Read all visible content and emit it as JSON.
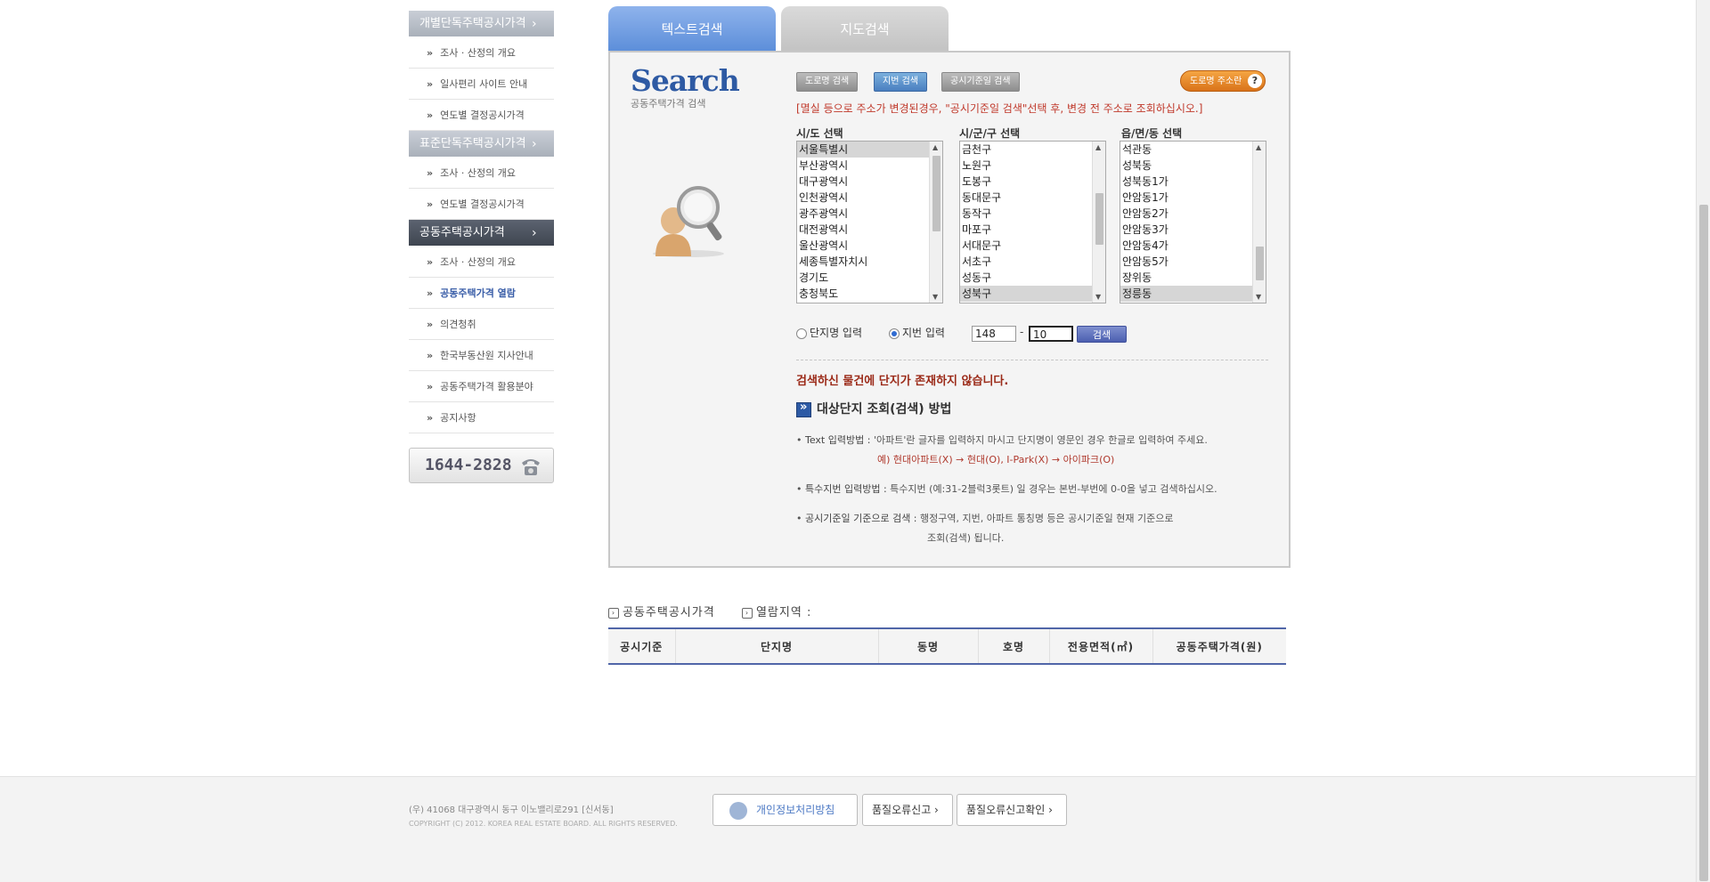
{
  "sidebar": {
    "sections": [
      {
        "title": "개별단독주택공시가격",
        "items": [
          "조사 · 산정의 개요",
          "일사편리 사이트 안내",
          "연도별 결정공시가격"
        ]
      },
      {
        "title": "표준단독주택공시가격",
        "items": [
          "조사 · 산정의 개요",
          "연도별 결정공시가격"
        ]
      },
      {
        "title": "공동주택공시가격",
        "items": [
          "조사 · 산정의 개요",
          "공동주택가격 열람",
          "의견청취",
          "한국부동산원 지사안내",
          "공동주택가격 활용분야",
          "공지사항"
        ]
      }
    ],
    "arrow": "›",
    "bullet": "»",
    "phone": "1644-2828"
  },
  "tabs": {
    "text_search": "텍스트검색",
    "map_search": "지도검색"
  },
  "search": {
    "logo_big": "Search",
    "logo_small": "공동주택가격 검색",
    "btn_road": "도로명 검색",
    "btn_jibun": "지번 검색",
    "btn_date": "공시기준일 검색",
    "road_info": "도로명 주소란",
    "road_info_q": "?",
    "notice": "[멸실 등으로 주소가 변경된경우, \"공시기준일 검색\"선택 후, 변경 전 주소로 조회하십시오.]",
    "sido_label": "시/도 선택",
    "sigungu_label": "시/군/구 선택",
    "eupmyeondong_label": "읍/면/동 선택",
    "sido_options": [
      "서울특별시",
      "부산광역시",
      "대구광역시",
      "인천광역시",
      "광주광역시",
      "대전광역시",
      "울산광역시",
      "세종특별자치시",
      "경기도",
      "충청북도"
    ],
    "sigungu_options": [
      "금천구",
      "노원구",
      "도봉구",
      "동대문구",
      "동작구",
      "마포구",
      "서대문구",
      "서초구",
      "성동구",
      "성북구"
    ],
    "dong_options": [
      "석관동",
      "성북동",
      "성북동1가",
      "안암동1가",
      "안암동2가",
      "안암동3가",
      "안암동4가",
      "안암동5가",
      "장위동",
      "정릉동"
    ],
    "radio_complex": "단지명 입력",
    "radio_bunji": "지번 입력",
    "bunji_main": "148",
    "bunji_dash": "-",
    "bunji_sub": "10",
    "search_btn": "검색",
    "no_result": "검색하신 물건에 단지가 존재하지 않습니다.",
    "howto_title": "대상단지 조회(검색) 방법",
    "guide1_label": "Text 입력방법 :",
    "guide1_text": "'아파트'란 글자를 입력하지 마시고 단지명이 영문인 경우 한글로 입력하여 주세요.",
    "guide1_example": "예) 현대아파트(X) → 현대(O), I-Park(X) → 아이파크(O)",
    "guide2_label": "특수지번 입력방법 :",
    "guide2_text": "특수지번 (예:31-2블럭3롯트) 일 경우는 본번-부번에 0-0을 넣고 검색하십시오.",
    "guide3_label": "공시기준일 기준으로 검색 :",
    "guide3_text": "행정구역, 지번, 아파트 통칭명 등은 공시기준일 현재 기준으로",
    "guide3_text2": "조회(검색) 됩니다.",
    "bullet": "•"
  },
  "result": {
    "head1": "공동주택공시가격",
    "head2": "열람지역 :",
    "columns": [
      "공시기준",
      "단지명",
      "동명",
      "호명",
      "전용면적(㎡)",
      "공동주택가격(원)"
    ]
  },
  "footer": {
    "address": "(우) 41068   대구광역시 동구 이노밸리로291 [신서동]",
    "copyright": "COPYRIGHT (C) 2012. KOREA REAL ESTATE BOARD. ALL RIGHTS RESERVED.",
    "privacy": "개인정보처리방침",
    "report": "품질오류신고 ›",
    "report_check": "품질오류신고확인 ›"
  }
}
